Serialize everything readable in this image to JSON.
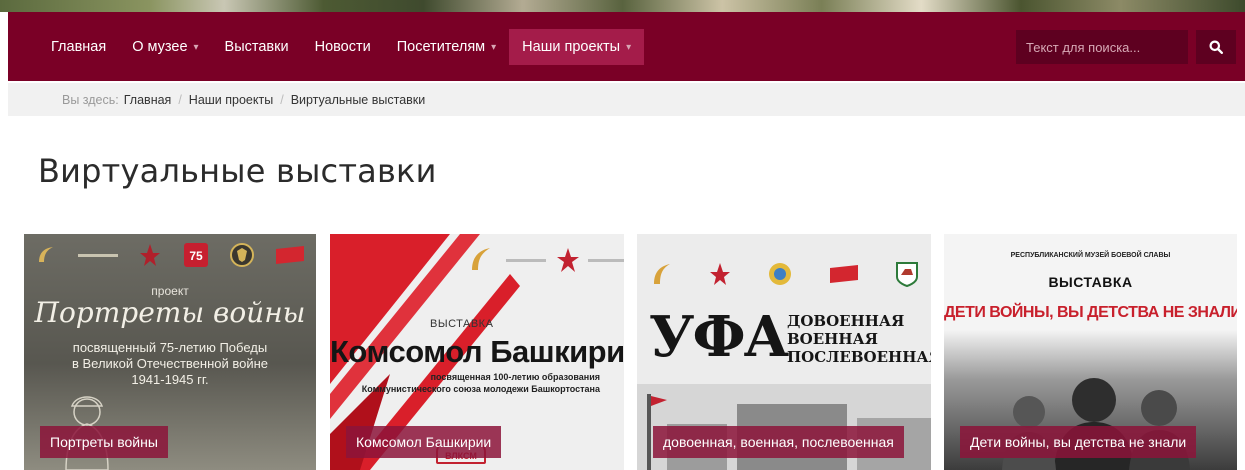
{
  "nav": {
    "items": [
      {
        "label": "Главная",
        "dropdown": false,
        "active": false
      },
      {
        "label": "О музее",
        "dropdown": true,
        "active": false
      },
      {
        "label": "Выставки",
        "dropdown": false,
        "active": false
      },
      {
        "label": "Новости",
        "dropdown": false,
        "active": false
      },
      {
        "label": "Посетителям",
        "dropdown": true,
        "active": false
      },
      {
        "label": "Наши проекты",
        "dropdown": true,
        "active": true
      }
    ],
    "search_placeholder": "Текст для поиска...",
    "search_icon": "search-icon"
  },
  "breadcrumb": {
    "prefix": "Вы здесь:",
    "items": [
      "Главная",
      "Наши проекты",
      "Виртуальные выставки"
    ]
  },
  "page_title": "Виртуальные выставки",
  "cards": [
    {
      "caption": "Портреты войны",
      "poster": {
        "kicker": "проект",
        "title": "Портреты войны",
        "subtitle_1": "посвященный 75-летию Победы",
        "subtitle_2": "в Великой Отечественной войне",
        "subtitle_3": "1941-1945 гг."
      }
    },
    {
      "caption": "Комсомол Башкирии",
      "poster": {
        "kicker": "ВЫСТАВКА",
        "title": "Комсомол Башкирии",
        "subtitle_1": "посвященная 100-летию образования",
        "subtitle_2": "Коммунистического союза молодежи Башкортостана",
        "badge": "ВЛКСМ"
      }
    },
    {
      "caption": "довоенная, военная, послевоенная",
      "poster": {
        "title": "УФА",
        "line_1": "ДОВОЕННАЯ",
        "line_2": "ВОЕННАЯ",
        "line_3": "ПОСЛЕВОЕННАЯ"
      }
    },
    {
      "caption": "Дети войны, вы детства не знали",
      "poster": {
        "museum": "РЕСПУБЛИКАНСКИЙ МУЗЕЙ БОЕВОЙ СЛАВЫ",
        "kicker": "ВЫСТАВКА",
        "title": "ДЕТИ ВОЙНЫ, ВЫ ДЕТСТВА НЕ ЗНАЛИ"
      }
    }
  ],
  "colors": {
    "navbar": "#7a0026",
    "active_nav": "#a41c4a",
    "search_bg": "#5e0020",
    "caption_bg": "#8c143a"
  }
}
